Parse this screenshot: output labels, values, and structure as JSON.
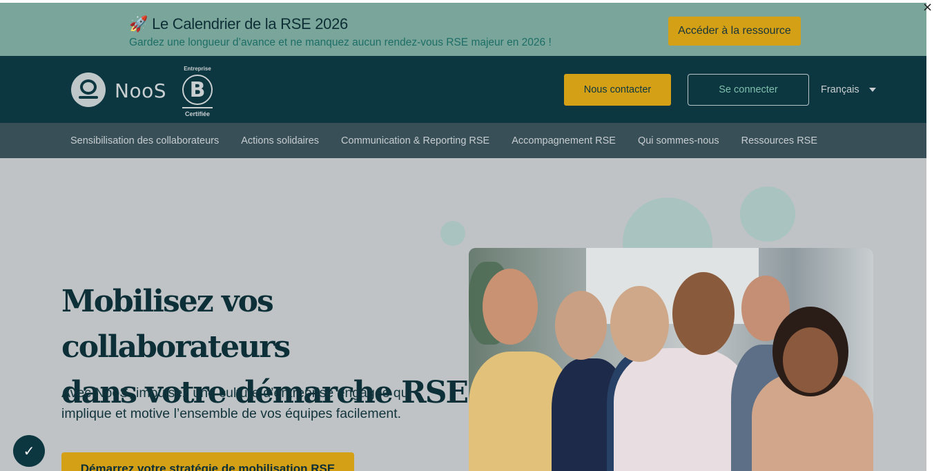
{
  "announcement": {
    "icon": "rocket-icon",
    "title": "Le Calendrier de la RSE 2026",
    "subtitle": "Gardez une longueur d’avance et ne manquez aucun rendez-vous RSE majeur en 2026 !",
    "button_label": "Accéder à la ressource",
    "close_label": "×"
  },
  "header": {
    "logo_text": "NooS",
    "bcorp": {
      "top": "Entreprise",
      "letter": "B",
      "bottom": "Certifiée"
    },
    "contact_label": "Nous contacter",
    "login_label": "Se connecter",
    "language": "Français"
  },
  "nav": {
    "items": [
      {
        "label": "Sensibilisation des collaborateurs"
      },
      {
        "label": "Actions solidaires"
      },
      {
        "label": "Communication & Reporting RSE"
      },
      {
        "label": "Accompagnement RSE"
      },
      {
        "label": "Qui sommes-nous"
      },
      {
        "label": "Ressources RSE"
      }
    ]
  },
  "hero": {
    "title_line1": "Mobilisez vos collaborateurs",
    "title_line2": "dans votre démarche RSE",
    "subtitle": "Avec NooS, impulsez une culture d’entreprise engagée qui implique et motive l’ensemble de vos équipes facilement.",
    "cta_label": "Démarrez votre stratégie de mobilisation RSE"
  },
  "colors": {
    "announce_bg": "#7aa59a",
    "header_bg": "#0c3640",
    "nav_bg": "#384f58",
    "accent": "#d4a016",
    "hero_bg": "#bfc3c5"
  },
  "icons": {
    "accessibility": "accessibility-check-icon",
    "language_caret": "chevron-down-icon"
  }
}
